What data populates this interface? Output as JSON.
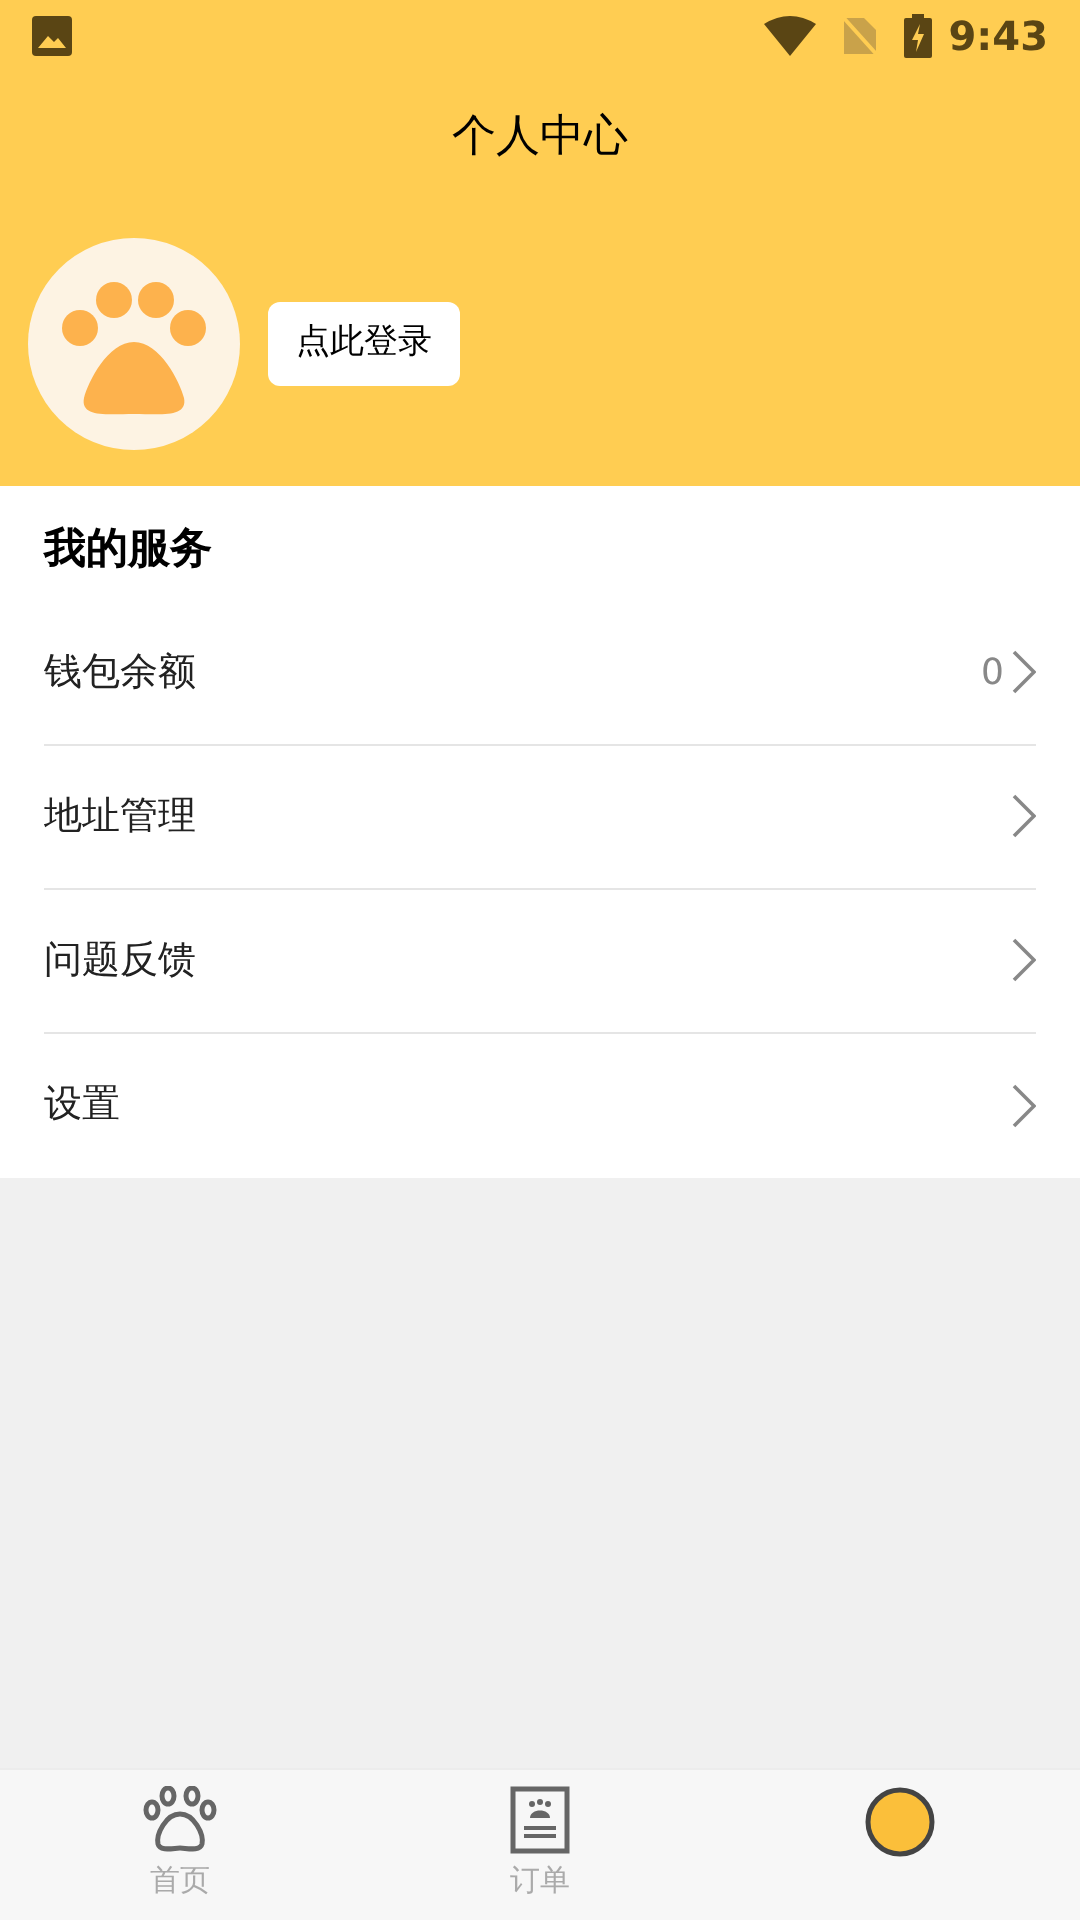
{
  "status_bar": {
    "time": "9:43"
  },
  "header": {
    "title": "个人中心",
    "login_button": "点此登录"
  },
  "services": {
    "title": "我的服务",
    "items": [
      {
        "label": "钱包余额",
        "value": "0"
      },
      {
        "label": "地址管理"
      },
      {
        "label": "问题反馈"
      },
      {
        "label": "设置"
      }
    ]
  },
  "tab_bar": [
    {
      "kind": "paw",
      "label": "首页",
      "selected": false
    },
    {
      "kind": "order",
      "label": "订单",
      "selected": false
    },
    {
      "kind": "profile",
      "selected": true
    }
  ]
}
